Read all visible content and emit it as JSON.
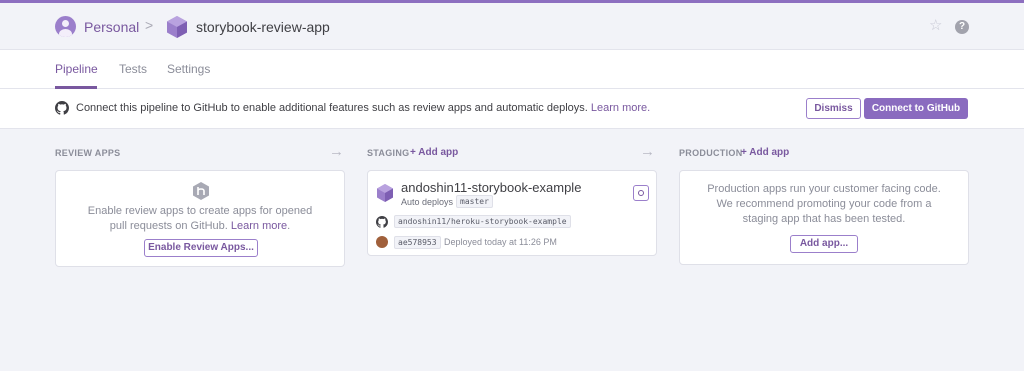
{
  "colors": {
    "accent": "#79589f",
    "accent_button": "#8a6bbf",
    "background": "#f2f3f8"
  },
  "header": {
    "account_icon": "user-avatar-icon",
    "account": "Personal",
    "separator": ">",
    "pipeline_icon": "hexagon-icon",
    "pipeline_name": "storybook-review-app",
    "star_icon": "☆",
    "help_icon": "?"
  },
  "tabs": [
    {
      "label": "Pipeline",
      "active": true
    },
    {
      "label": "Tests",
      "active": false
    },
    {
      "label": "Settings",
      "active": false
    }
  ],
  "banner": {
    "icon": "github-icon",
    "text": "Connect this pipeline to GitHub to enable additional features such as review apps and automatic deploys.",
    "link": "Learn more.",
    "dismiss_label": "Dismiss",
    "connect_label": "Connect to GitHub"
  },
  "review_apps": {
    "title": "REVIEW APPS",
    "icon": "review-apps-hexagon-icon",
    "text": "Enable review apps to create apps for opened pull requests on GitHub.",
    "link": "Learn more",
    "link_suffix": ".",
    "button_label": "Enable Review Apps..."
  },
  "staging": {
    "title": "STAGING",
    "add_app": "+ Add app",
    "app": {
      "name": "andoshin11-storybook-example",
      "auto_deploys_label": "Auto deploys",
      "branch": "master",
      "repo": "andoshin11/heroku-storybook-example",
      "commit": "ae578953",
      "deployed": "Deployed today at 11:26 PM"
    }
  },
  "production": {
    "title": "PRODUCTION",
    "add_app": "+ Add app",
    "text": "Production apps run your customer facing code. We recommend promoting your code from a staging app that has been tested.",
    "button_label": "Add app..."
  },
  "arrows": [
    "→",
    "→"
  ]
}
